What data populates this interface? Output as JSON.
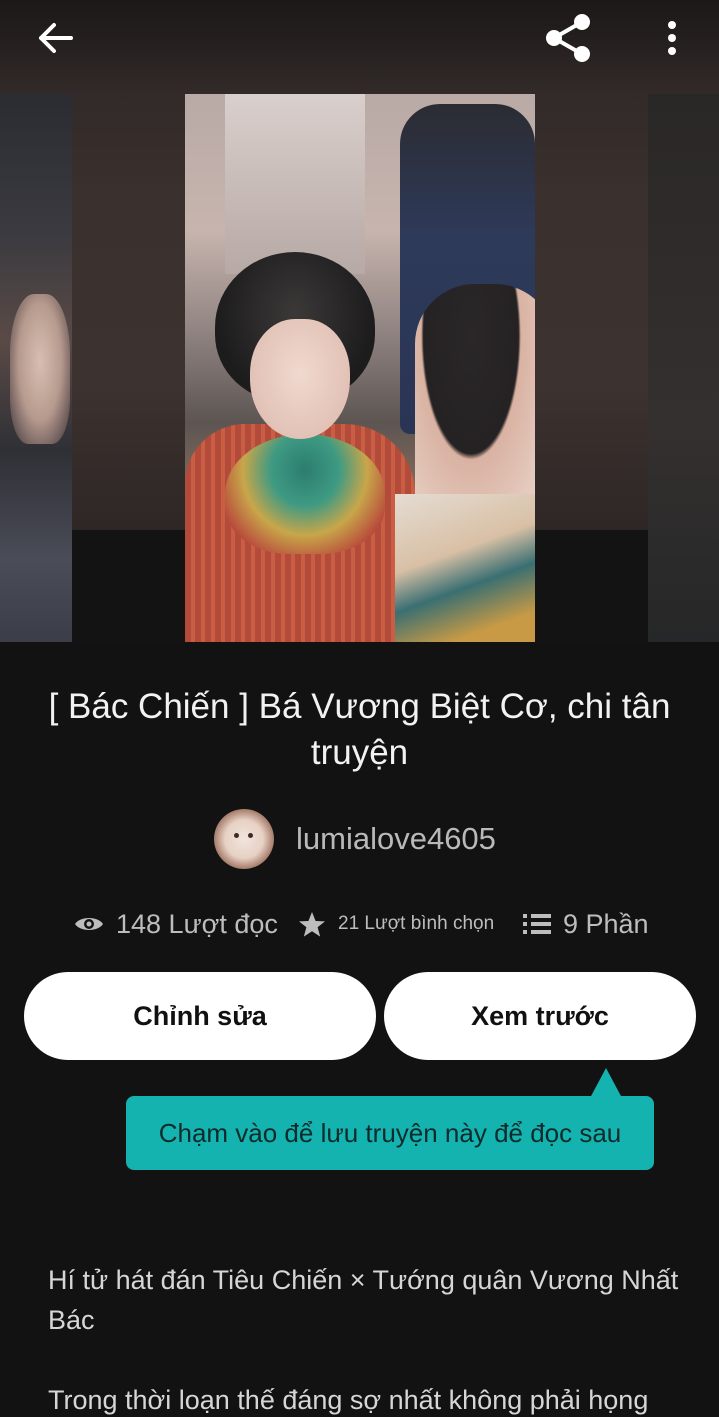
{
  "header": {
    "back_icon": "arrow-left-icon",
    "share_icon": "share-icon",
    "more_icon": "more-vertical-icon"
  },
  "story": {
    "title": "[ Bác Chiến ] Bá Vương Biệt Cơ, chi tân truyện",
    "author": "lumialove4605"
  },
  "stats": {
    "reads": "148 Lượt đọc",
    "votes": "21 Lượt bình chọn",
    "parts": "9 Phần"
  },
  "actions": {
    "edit_label": "Chỉnh sửa",
    "preview_label": "Xem trước"
  },
  "tooltip": {
    "text": "Chạm vào để lưu truyện này để đọc sau"
  },
  "description": {
    "paragraph1": "Hí tử hát đán Tiêu Chiến × Tướng quân Vương Nhất Bác",
    "paragraph2": "Trong thời loạn thế đáng sợ nhất không phải họng"
  },
  "colors": {
    "background": "#121212",
    "accent_tooltip": "#14b3b0",
    "button_bg": "#ffffff"
  }
}
